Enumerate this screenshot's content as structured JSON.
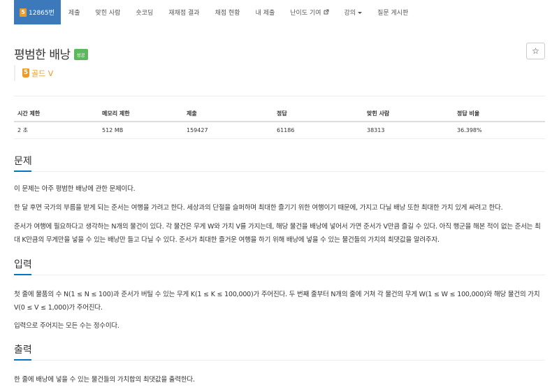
{
  "nav": {
    "problem_number": "12865번",
    "problem_badge": "5",
    "items": [
      "제출",
      "맞힌 사람",
      "숏코딩",
      "재채점 결과",
      "채점 현황",
      "내 제출",
      "난이도 기여",
      "강의",
      "질문 게시판"
    ]
  },
  "problem": {
    "title": "평범한 배낭",
    "status_label": "성공",
    "star": "☆",
    "tier_number": "5",
    "tier_name": "골드 V"
  },
  "info_table": {
    "headers": [
      "시간 제한",
      "메모리 제한",
      "제출",
      "정답",
      "맞힌 사람",
      "정답 비율"
    ],
    "values": [
      "2 초",
      "512 MB",
      "159427",
      "61186",
      "38313",
      "36.398%"
    ]
  },
  "sections": {
    "description": {
      "heading": "문제",
      "paragraphs": [
        "이 문제는 아주 평범한 배낭에 관한 문제이다.",
        "한 달 후면 국가의 부름을 받게 되는 준서는 여행을 가려고 한다. 세상과의 단절을 슬퍼하며 최대한 즐기기 위한 여행이기 때문에, 가지고 다닐 배낭 또한 최대한 가치 있게 싸려고 한다.",
        "준서가 여행에 필요하다고 생각하는 N개의 물건이 있다. 각 물건은 무게 W와 가치 V를 가지는데, 해당 물건을 배낭에 넣어서 가면 준서가 V만큼 즐길 수 있다. 아직 행군을 해본 적이 없는 준서는 최대 K만큼의 무게만을 넣을 수 있는 배낭만 들고 다닐 수 있다. 준서가 최대한 즐거운 여행을 하기 위해 배낭에 넣을 수 있는 물건들의 가치의 최댓값을 알려주자."
      ]
    },
    "input": {
      "heading": "입력",
      "paragraphs": [
        "첫 줄에 물품의 수 N(1 ≤ N ≤ 100)과 준서가 버틸 수 있는 무게 K(1 ≤ K ≤ 100,000)가 주어진다. 두 번째 줄부터 N개의 줄에 거쳐 각 물건의 무게 W(1 ≤ W ≤ 100,000)와 해당 물건의 가치 V(0 ≤ V ≤ 1,000)가 주어진다.",
        "입력으로 주어지는 모든 수는 정수이다."
      ]
    },
    "output": {
      "heading": "출력",
      "paragraphs": [
        "한 줄에 배낭에 넣을 수 있는 물건들의 가치합의 최댓값을 출력한다."
      ]
    }
  }
}
